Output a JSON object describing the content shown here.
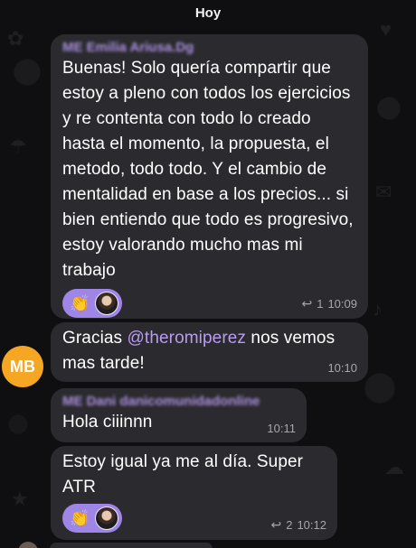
{
  "date_label": "Hoy",
  "messages": [
    {
      "sender": "ME Emilia Ariusa.Dg",
      "text": "Buenas! Solo quería compartir que estoy a pleno con todos los ejercicios y re contenta con todo lo creado hasta el momento, la propuesta, el metodo, todo todo. Y el cambio de mentalidad en base a los precios... si bien entiendo que todo es progresivo, estoy valorando mucho mas mi trabajo",
      "reaction_emoji": "👏",
      "replies": "1",
      "time": "10:09"
    },
    {
      "avatar_initials": "MB",
      "text_before": "Gracias ",
      "mention": "@theromiperez",
      "text_after": " nos vemos mas tarde!",
      "time": "10:10"
    },
    {
      "sender": "ME Dani danicomunidadonline",
      "text": "Hola ciiinnn",
      "time": "10:11"
    },
    {
      "text": "Estoy igual  ya me al día. Super ATR",
      "reaction_emoji": "👏",
      "replies": "2",
      "time": "10:12"
    }
  ],
  "colors": {
    "background": "#0f0f11",
    "bubble": "#2b2a2f",
    "accent": "#b99cf0",
    "reaction_pill": "#9f86e6",
    "avatar_mb": "#f5a623",
    "meta_text": "#a7a6ab"
  },
  "icons": {
    "reply": "reply-arrow-icon",
    "reaction_user": "user-avatar-icon"
  }
}
